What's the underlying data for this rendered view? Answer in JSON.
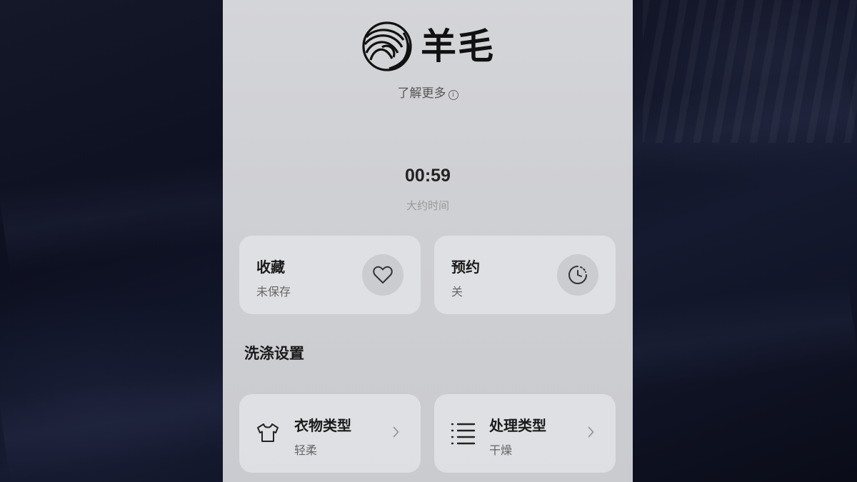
{
  "program": {
    "title": "羊毛",
    "learn_more": "了解更多",
    "info_glyph": "i",
    "logo_icon": "wool-yarn-icon"
  },
  "time": {
    "value": "00:59",
    "label": "大约时间"
  },
  "favorite": {
    "title": "收藏",
    "status": "未保存",
    "icon": "heart-icon"
  },
  "schedule": {
    "title": "预约",
    "status": "关",
    "icon": "clock-icon"
  },
  "wash_settings": {
    "title": "洗涤设置",
    "items": [
      {
        "title": "衣物类型",
        "value": "轻柔",
        "icon": "tshirt-icon"
      },
      {
        "title": "处理类型",
        "value": "干燥",
        "icon": "list-icon"
      }
    ]
  },
  "colors": {
    "panel": "#d0d1d5",
    "card": "#e2e3e6",
    "text_primary": "#1a1a1a",
    "text_secondary": "#666666",
    "background": "#111526"
  }
}
